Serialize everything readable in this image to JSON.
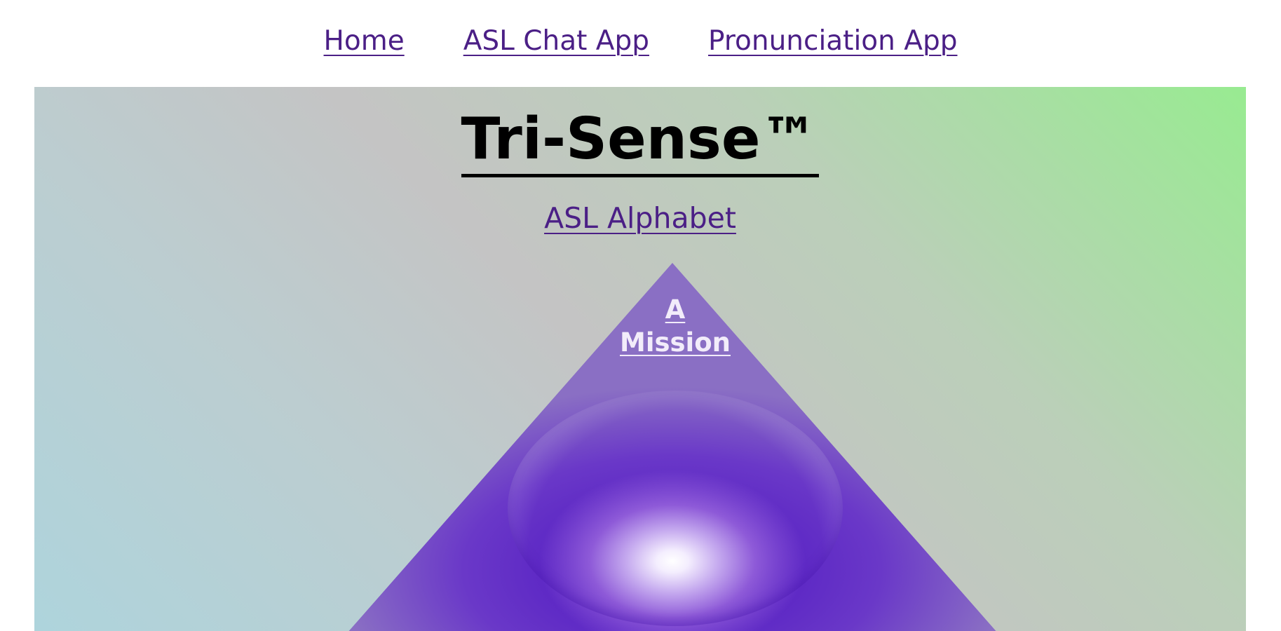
{
  "nav": {
    "items": [
      {
        "label": "Home"
      },
      {
        "label": "ASL Chat App"
      },
      {
        "label": "Pronunciation App"
      }
    ]
  },
  "hero": {
    "title": "Tri-Sense™",
    "subtitle_link": "ASL Alphabet",
    "pyramid_link_line1": "A",
    "pyramid_link_line2": "Mission"
  },
  "colors": {
    "link": "#4b1f86",
    "title": "#000000",
    "gradient_green": "#98eb91",
    "gradient_gray": "#c4c4c4",
    "gradient_blue": "#aed4dc",
    "pyramid_purple": "#5a24c4"
  }
}
